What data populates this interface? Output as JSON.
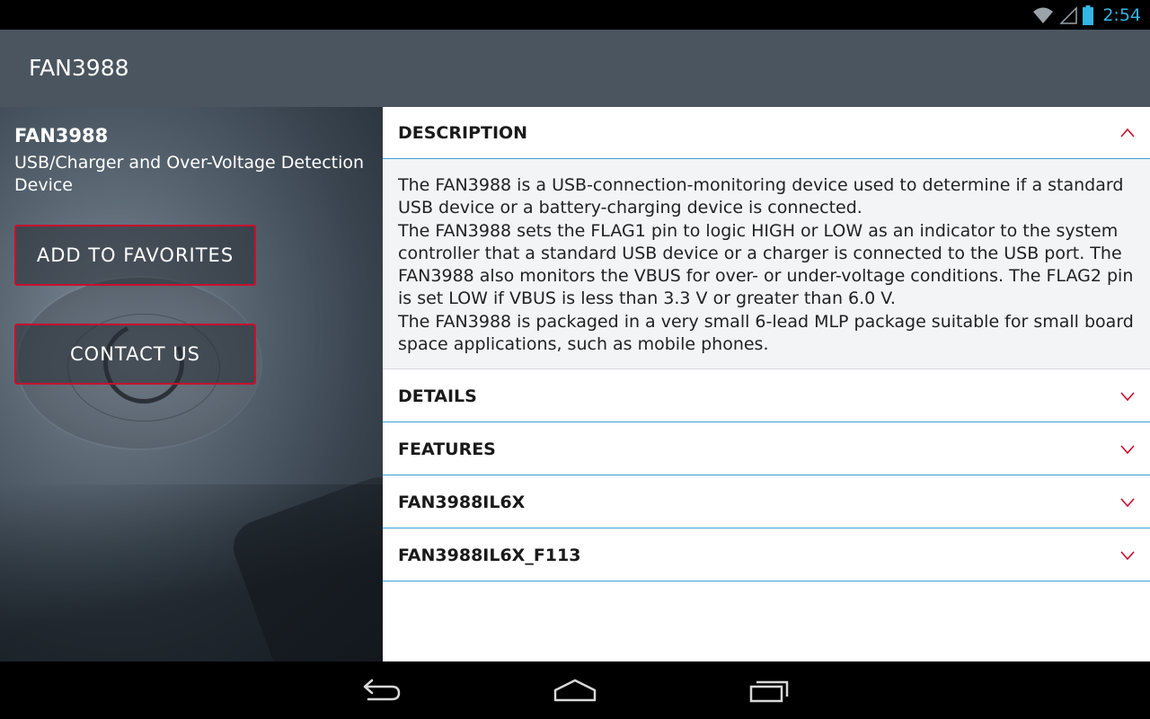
{
  "status_bar": {
    "time": "2:54",
    "icons": [
      "wifi-icon",
      "signal-icon",
      "battery-icon"
    ],
    "accent_color": "#33b5e5"
  },
  "action_bar": {
    "title": "FAN3988",
    "background": "#4a5560"
  },
  "product": {
    "name": "FAN3988",
    "description": "USB/Charger and Over-Voltage Detection Device"
  },
  "buttons": {
    "add_favorites": "ADD TO FAVORITES",
    "contact_us": "CONTACT US",
    "border_color": "#c8102e"
  },
  "sections": [
    {
      "title": "DESCRIPTION",
      "expanded": true,
      "body": [
        "The FAN3988 is a USB-connection-monitoring device used to determine if a standard USB device or a battery-charging device is connected.",
        "The FAN3988 sets the FLAG1 pin to logic HIGH or LOW as an indicator to the system controller that a standard USB device or a charger is connected to the USB port. The FAN3988 also monitors the VBUS for over- or under-voltage conditions. The FLAG2 pin is set LOW if VBUS is less than 3.3 V or greater than 6.0 V.",
        "The FAN3988 is packaged in a very small 6-lead MLP package suitable for small board space applications, such as mobile phones."
      ]
    },
    {
      "title": "DETAILS",
      "expanded": false
    },
    {
      "title": "FEATURES",
      "expanded": false
    },
    {
      "title": "FAN3988IL6X",
      "expanded": false
    },
    {
      "title": "FAN3988IL6X_F113",
      "expanded": false
    }
  ],
  "nav_bar": {
    "icons": [
      "back-icon",
      "home-icon",
      "recent-apps-icon"
    ]
  }
}
